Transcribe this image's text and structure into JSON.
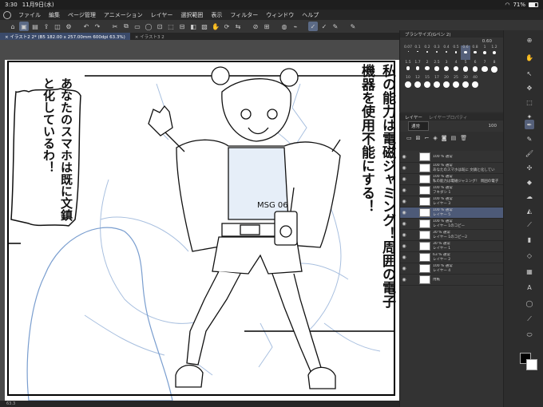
{
  "status": {
    "time": "3:30",
    "date": "11月9日(水)",
    "battery": "71%"
  },
  "menu": [
    "ファイル",
    "編集",
    "ページ管理",
    "アニメーション",
    "レイヤー",
    "選択範囲",
    "表示",
    "フィルター",
    "ウィンドウ",
    "ヘルプ"
  ],
  "tabs": [
    {
      "label": "× イラスト2 2* (B5 182.00 x 257.00mm 600dpi 63.3%)"
    },
    {
      "label": "× イラスト3 2"
    }
  ],
  "canvas": {
    "bubble_left": "あなたのスマホは既に文鎮と化しているわ！",
    "bubble_right": "私の能力は電磁ジャミング！周囲の電子機器を使用不能にする！",
    "badge": "MSG 06"
  },
  "bottom_zoom": "63.3",
  "brush_panel": {
    "title": "ブラシサイズ(Gペン 2)",
    "value": "0.60",
    "sizes": [
      "0.07",
      "0.1",
      "0.2",
      "0.3",
      "0.4",
      "0.5",
      "0.6",
      "0.8",
      "1",
      "1.2",
      "1.5",
      "1.7",
      "2",
      "2.5",
      "3",
      "4",
      "5",
      "6",
      "7",
      "8",
      "10",
      "12",
      "15",
      "17",
      "20",
      "25",
      "30",
      "40"
    ],
    "selected_size": "0.6"
  },
  "layer_panel": {
    "title": "レイヤー",
    "tab2": "レイヤープロパティ",
    "blend": "通常",
    "opacity": "100",
    "layers": [
      {
        "mode": "100 % 通常",
        "name": "",
        "selected": false
      },
      {
        "mode": "100 % 通常",
        "name": "あなたのスマホは既に 文鎮と化してい",
        "selected": false
      },
      {
        "mode": "100 % 通常",
        "name": "私の能力は電磁ジャミング！ 周囲の電子",
        "selected": false
      },
      {
        "mode": "100 % 通常",
        "name": "フキダシ 1",
        "selected": false
      },
      {
        "mode": "100 % 通常",
        "name": "レイヤー 3",
        "selected": false
      },
      {
        "mode": "100 % 通常",
        "name": "レイヤー 5",
        "selected": true
      },
      {
        "mode": "100 % 通常",
        "name": "レイヤー 1のコピー",
        "selected": false
      },
      {
        "mode": "30 % 通常",
        "name": "レイヤー 1のコピー2",
        "selected": false
      },
      {
        "mode": "30 % 通常",
        "name": "レイヤー 1",
        "selected": false
      },
      {
        "mode": "63 % 通常",
        "name": "レイヤー 2",
        "selected": false
      },
      {
        "mode": "100 % 通常",
        "name": "レイヤー 4",
        "selected": false
      },
      {
        "mode": "",
        "name": "用紙",
        "selected": false
      }
    ]
  }
}
